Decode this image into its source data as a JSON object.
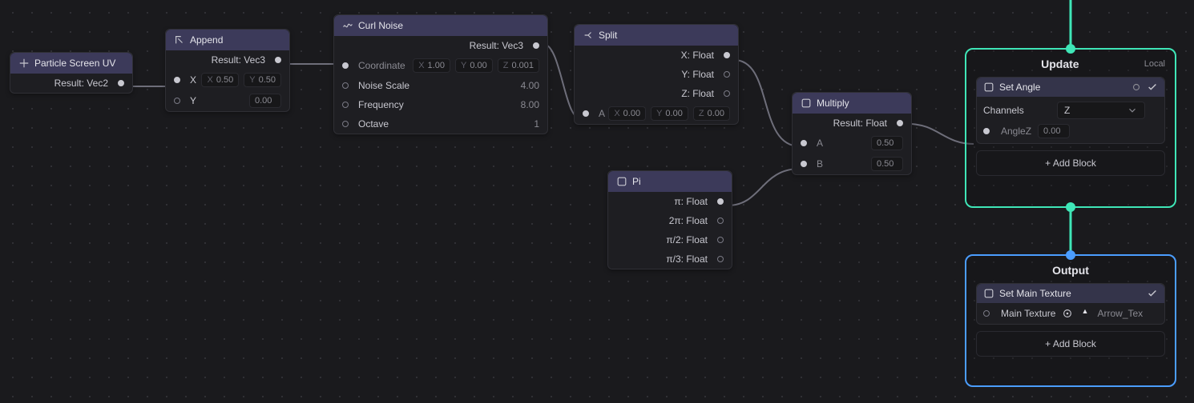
{
  "nodes": {
    "particleScreenUV": {
      "title": "Particle Screen UV",
      "resultLabel": "Result:",
      "resultType": "Vec2"
    },
    "append": {
      "title": "Append",
      "resultLabel": "Result:",
      "resultType": "Vec3",
      "inputs": {
        "x": {
          "label": "X",
          "xv": "0.50",
          "yv": "0.50"
        },
        "y": {
          "label": "Y",
          "v": "0.00"
        }
      }
    },
    "curlNoise": {
      "title": "Curl Noise",
      "resultLabel": "Result:",
      "resultType": "Vec3",
      "rows": {
        "coord": {
          "label": "Coordinate",
          "x": "1.00",
          "y": "0.00",
          "z": "0.001"
        },
        "noiseScale": {
          "label": "Noise Scale",
          "v": "4.00"
        },
        "frequency": {
          "label": "Frequency",
          "v": "8.00"
        },
        "octave": {
          "label": "Octave",
          "v": "1"
        }
      }
    },
    "split": {
      "title": "Split",
      "outputs": {
        "x": "X: Float",
        "y": "Y: Float",
        "z": "Z: Float"
      },
      "inputA": {
        "label": "A",
        "x": "0.00",
        "y": "0.00",
        "z": "0.00"
      }
    },
    "pi": {
      "title": "Pi",
      "outs": {
        "pi": "π: Float",
        "twopi": "2π: Float",
        "halfpi": "π/2: Float",
        "thirdpi": "π/3: Float"
      }
    },
    "multiply": {
      "title": "Multiply",
      "resultLabel": "Result:",
      "resultType": "Float",
      "a": {
        "label": "A",
        "v": "0.50"
      },
      "b": {
        "label": "B",
        "v": "0.50"
      }
    }
  },
  "contexts": {
    "update": {
      "title": "Update",
      "sub": "Local",
      "block": {
        "title": "Set Angle",
        "channelsLabel": "Channels",
        "channelsValue": "Z",
        "angle": {
          "label": "AngleZ",
          "v": "0.00"
        }
      },
      "addBlock": "+ Add Block"
    },
    "output": {
      "title": "Output",
      "block": {
        "title": "Set Main Texture",
        "prop": {
          "label": "Main Texture",
          "value": "Arrow_Tex"
        }
      },
      "addBlock": "+ Add Block"
    }
  }
}
